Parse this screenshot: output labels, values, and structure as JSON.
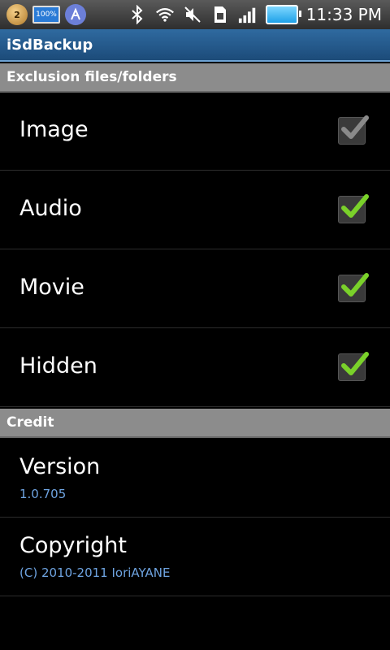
{
  "status_bar": {
    "notification_count": "2",
    "notification_battery": "100%",
    "time": "11:33 PM",
    "icons": [
      "coin-notification-icon",
      "battery-notification-icon",
      "app-notification-icon",
      "bluetooth-icon",
      "wifi-icon",
      "mute-icon",
      "sim-icon",
      "signal-icon",
      "battery-icon"
    ]
  },
  "app": {
    "title": "iSdBackup"
  },
  "sections": [
    {
      "header": "Exclusion files/folders",
      "items": [
        {
          "label": "Image",
          "checked": true,
          "enabled": false
        },
        {
          "label": "Audio",
          "checked": true,
          "enabled": true
        },
        {
          "label": "Movie",
          "checked": true,
          "enabled": true
        },
        {
          "label": "Hidden",
          "checked": true,
          "enabled": true
        }
      ]
    },
    {
      "header": "Credit",
      "items": [
        {
          "label": "Version",
          "summary": "1.0.705"
        },
        {
          "label": "Copyright",
          "summary": "(C) 2010-2011 IoriAYANE"
        }
      ]
    }
  ],
  "colors": {
    "check_enabled": "#7ad12a",
    "check_disabled": "#8a8a8a",
    "summary_text": "#6ea3e0",
    "section_header": "#8c8c8c"
  }
}
